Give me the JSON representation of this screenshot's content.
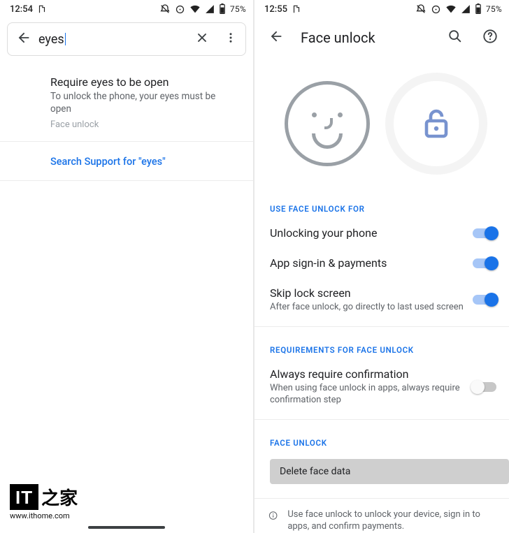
{
  "left": {
    "status": {
      "time": "12:54",
      "battery": "75%"
    },
    "search_value": "eyes",
    "result": {
      "title": "Require eyes to be open",
      "subtitle": "To unlock the phone, your eyes must be open",
      "path": "Face unlock"
    },
    "support_text": "Search Support for \"eyes\""
  },
  "right": {
    "status": {
      "time": "12:55",
      "battery": "75%"
    },
    "header_title": "Face unlock",
    "sections": {
      "use_for": "USE FACE UNLOCK FOR",
      "requirements": "REQUIREMENTS FOR FACE UNLOCK",
      "face_unlock": "FACE UNLOCK"
    },
    "settings": {
      "unlock_phone": {
        "title": "Unlocking your phone",
        "on": true
      },
      "app_signin": {
        "title": "App sign-in & payments",
        "on": true
      },
      "skip_lock": {
        "title": "Skip lock screen",
        "sub": "After face unlock, go directly to last used screen",
        "on": true
      },
      "require_confirm": {
        "title": "Always require confirmation",
        "sub": "When using face unlock in apps, always require confirmation step",
        "on": false
      }
    },
    "delete_label": "Delete face data",
    "footer_text": "Use face unlock to unlock your device, sign in to apps, and confirm payments."
  },
  "watermark": {
    "brand": "IT",
    "url": "www.ithome.com"
  }
}
